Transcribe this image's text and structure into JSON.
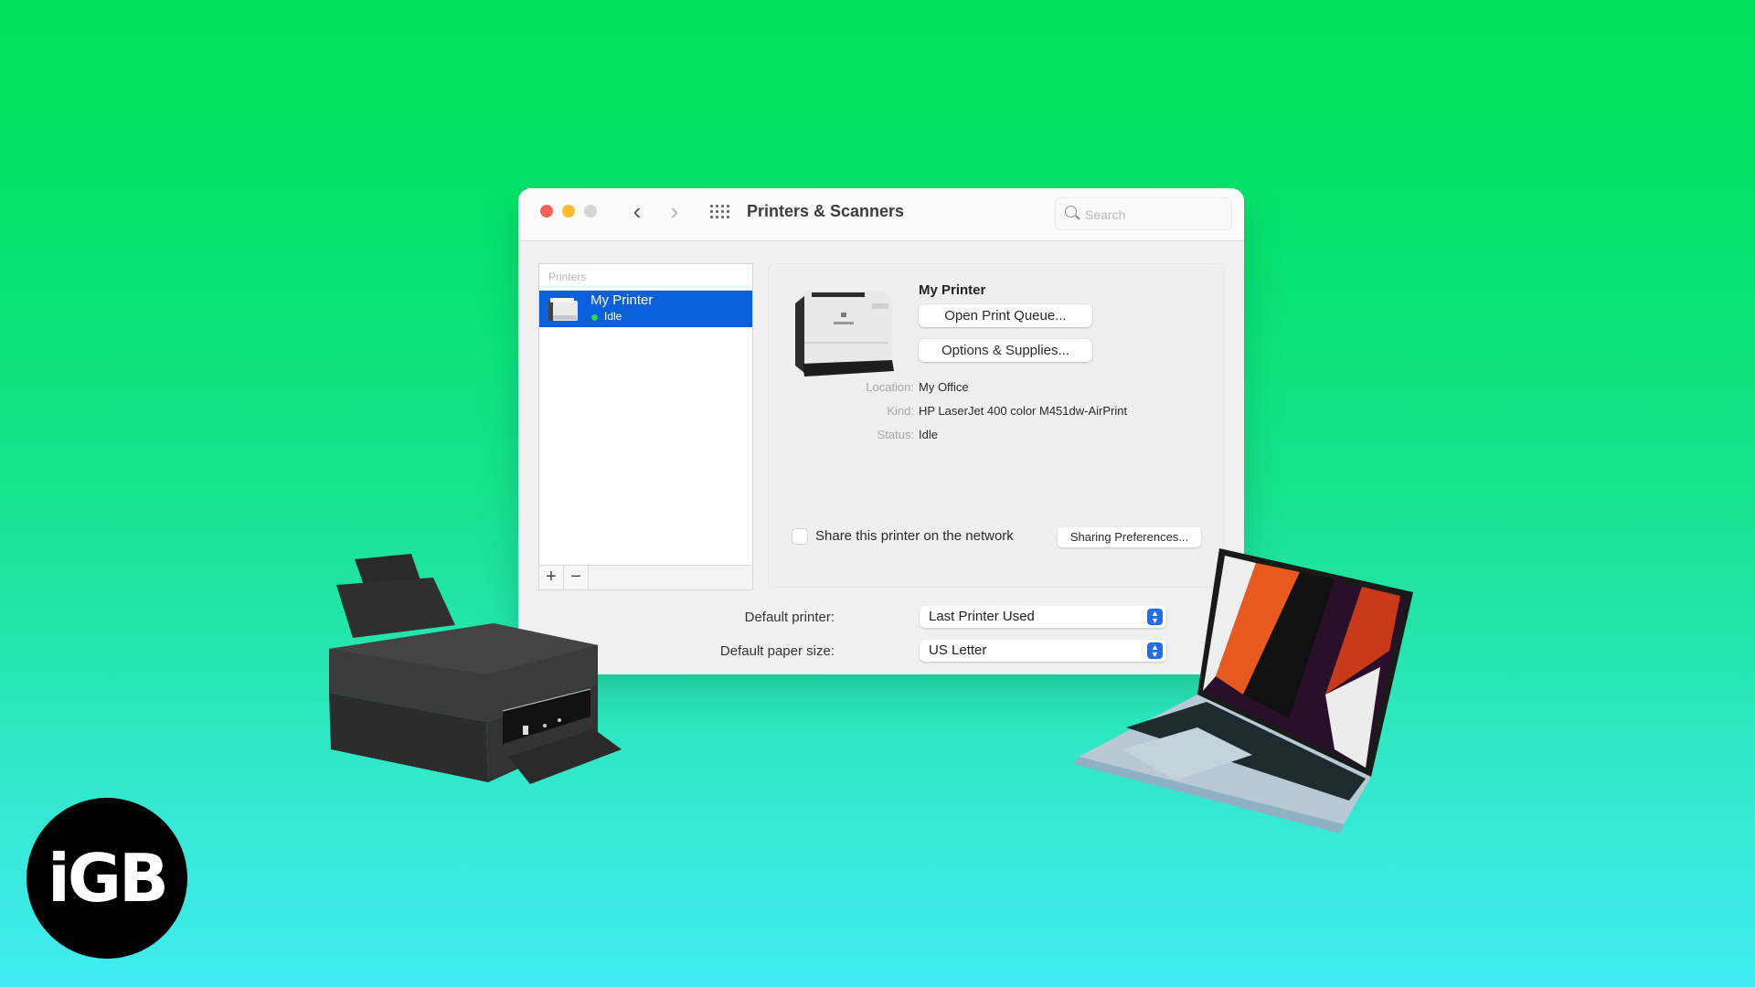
{
  "window": {
    "title": "Printers & Scanners",
    "nav": {
      "back_icon": "chevron-left-icon",
      "forward_icon": "chevron-right-icon",
      "grid_icon": "show-all-grid-icon"
    },
    "search": {
      "placeholder": "Search",
      "value": ""
    }
  },
  "printers_list": {
    "header": "Printers",
    "items": [
      {
        "name": "My Printer",
        "status": "Idle",
        "status_color": "#32d74b",
        "selected": true
      }
    ],
    "add_label": "+",
    "remove_label": "−"
  },
  "details": {
    "printer_name": "My Printer",
    "open_queue_label": "Open Print Queue...",
    "options_label": "Options & Supplies...",
    "fields": [
      {
        "key": "Location:",
        "value": "My Office"
      },
      {
        "key": "Kind:",
        "value": "HP LaserJet 400 color M451dw-AirPrint"
      },
      {
        "key": "Status:",
        "value": "Idle"
      }
    ],
    "share_label": "Share this printer on the network",
    "share_checked": false,
    "sharing_prefs_label": "Sharing Preferences..."
  },
  "defaults": {
    "printer_label": "Default printer:",
    "printer_value": "Last Printer Used",
    "paper_label": "Default paper size:",
    "paper_value": "US Letter"
  },
  "branding": {
    "logo_text": "iGB"
  },
  "colors": {
    "selection": "#0a5fdb",
    "accent": "#1e6ff0",
    "bg_top": "#00e25a",
    "bg_bottom": "#40ecf2"
  }
}
